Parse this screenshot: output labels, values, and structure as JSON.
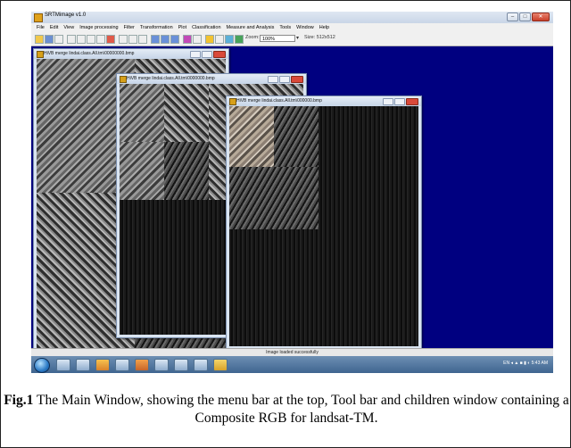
{
  "app": {
    "title": "SRTMimage v1.0",
    "window_buttons": {
      "minimize": "–",
      "maximize": "□",
      "close": "✕"
    }
  },
  "menubar": {
    "items": [
      "File",
      "Edit",
      "View",
      "Image processing",
      "Filter",
      "Transformation",
      "Plot",
      "Classification",
      "Measure and Analysis",
      "Tools",
      "Window",
      "Help"
    ]
  },
  "toolbar": {
    "zoom_label": "Zoom:",
    "zoom_value": "100%",
    "size_label": "Size: 512x512"
  },
  "children": [
    {
      "title": "HiVB merge lindai.class.All.tm\\00000000.bmp"
    },
    {
      "title": "HiVB merge lindai.class.All.tm\\0000000.bmp"
    },
    {
      "title": "HiVB merge lindai.class.All.tm\\000000.bmp"
    }
  ],
  "status": {
    "text": "Image loaded successfully"
  },
  "taskbar": {
    "tray_text": "EN  ◂  ▲  ■  ▮  ◐   5:43 AM"
  },
  "caption": {
    "label": "Fig.1",
    "text": " The Main Window, showing the menu bar at the top, Tool bar and children window containing a Composite RGB for landsat-TM."
  }
}
